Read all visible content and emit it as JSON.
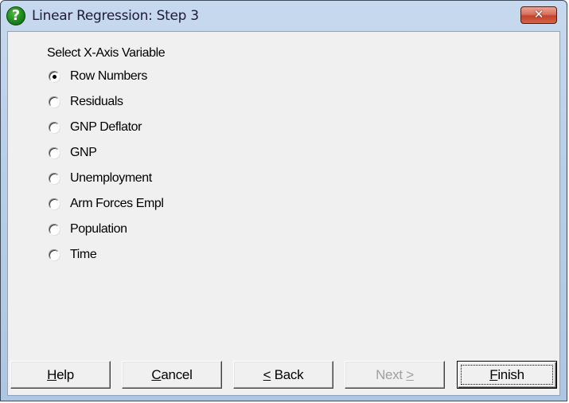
{
  "window": {
    "title": "Linear Regression: Step 3",
    "icon": "help-question-icon",
    "close_glyph": "✕"
  },
  "group": {
    "label": "Select X-Axis Variable",
    "selected_index": 0,
    "options": [
      {
        "label": "Row Numbers",
        "checked": true
      },
      {
        "label": "Residuals",
        "checked": false
      },
      {
        "label": "GNP Deflator",
        "checked": false
      },
      {
        "label": "GNP",
        "checked": false
      },
      {
        "label": "Unemployment",
        "checked": false
      },
      {
        "label": "Arm Forces Empl",
        "checked": false
      },
      {
        "label": "Population",
        "checked": false
      },
      {
        "label": "Time",
        "checked": false
      }
    ]
  },
  "buttons": {
    "help": {
      "mnemonic": "H",
      "rest": "elp",
      "enabled": true
    },
    "cancel": {
      "mnemonic": "C",
      "rest": "ancel",
      "enabled": true
    },
    "back": {
      "mnemonic": "<",
      "rest": " Back",
      "enabled": true
    },
    "next": {
      "prefix": "Next ",
      "mnemonic": ">",
      "enabled": false
    },
    "finish": {
      "mnemonic": "F",
      "rest": "inish",
      "enabled": true,
      "default": true
    }
  }
}
